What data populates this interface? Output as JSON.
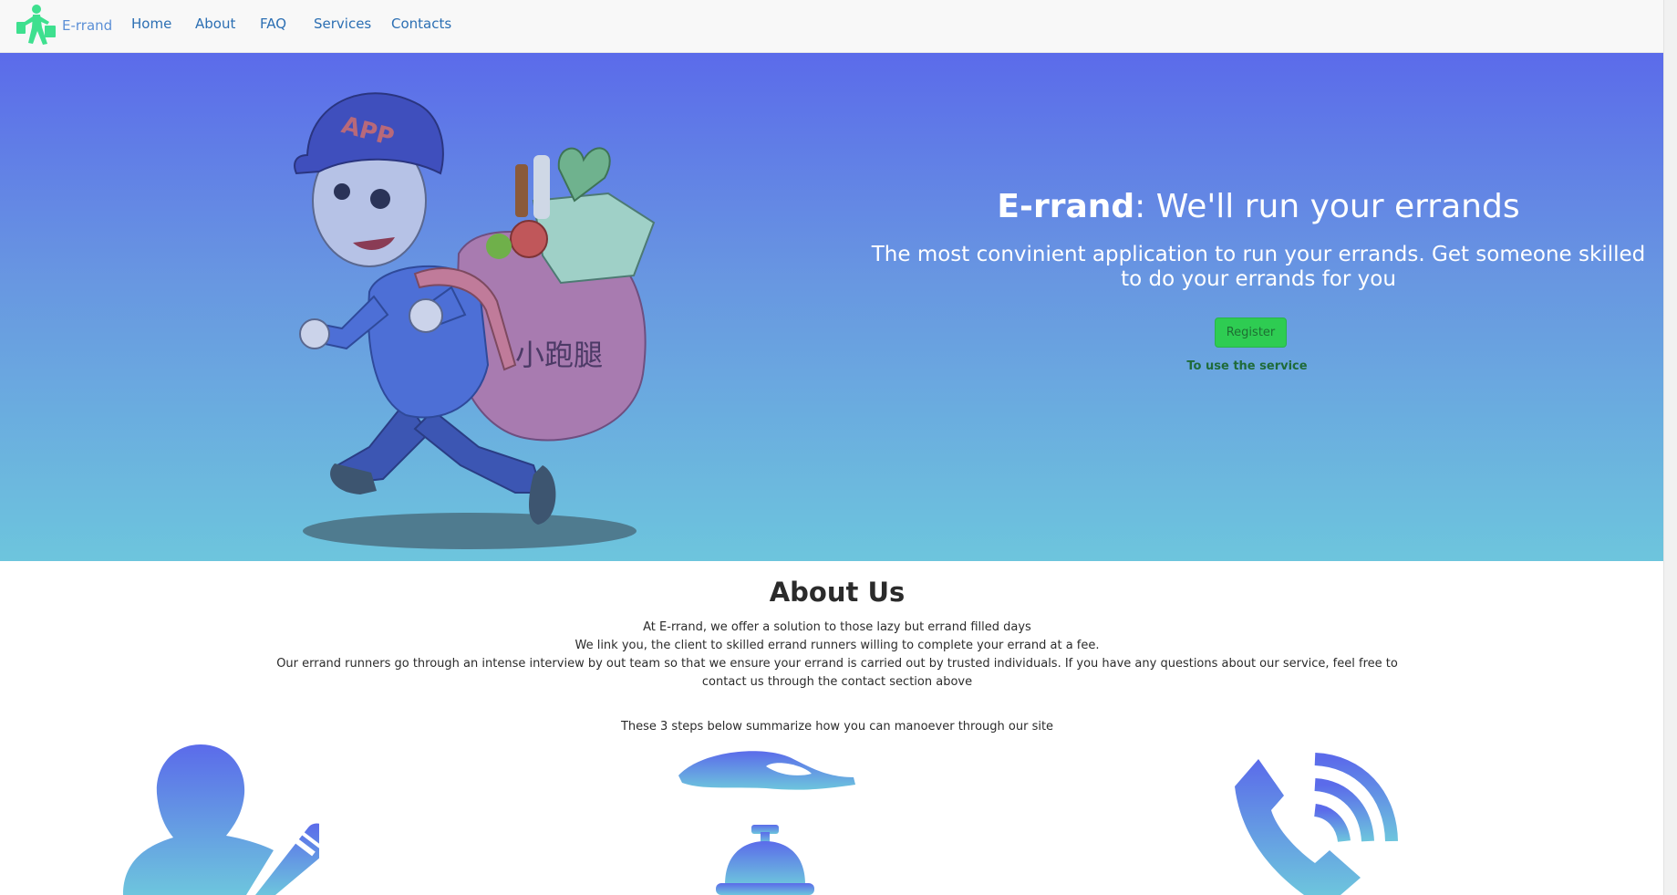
{
  "navbar": {
    "brand": "E-rrand",
    "links": [
      "Home",
      "About",
      "FAQ",
      "Services",
      "Contacts"
    ]
  },
  "hero": {
    "title_bold": "E-rrand",
    "title_rest": ": We'll run your errands",
    "subtitle": "The most convinient application to run your errands. Get someone skilled to do your errands for you",
    "register_label": "Register",
    "register_note": "To use the service",
    "illustration": {
      "cap_text": "APP",
      "bag_text": "小跑腿"
    }
  },
  "about": {
    "title": "About Us",
    "lines": [
      "At E-rrand, we offer a solution to those lazy but errand filled days",
      "We link you, the client to skilled errand runners willing to complete your errand at a fee.",
      "Our errand runners go through an intense interview by out team so that we ensure your errand is carried out by trusted individuals. If you have any questions about our service, feel free to contact us through the contact section above"
    ],
    "steps_intro": "These 3 steps below summarize how you can manoever through our site",
    "step_icons": [
      "user-edit-icon",
      "service-bell-icon",
      "phone-call-icon"
    ]
  },
  "colors": {
    "hero_top": "#5b6bea",
    "hero_bottom": "#6dc5dd",
    "register": "#2ecc52",
    "nav_link": "#2c6fb3"
  }
}
